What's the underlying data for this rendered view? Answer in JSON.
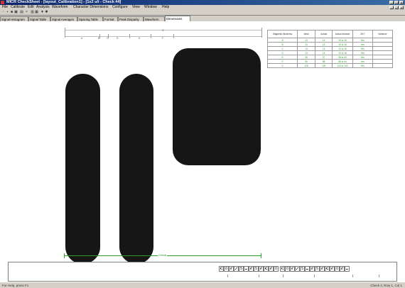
{
  "window": {
    "title": "MICR CheckSheet - [layout_Calibration1] - [1x2 u/i - Check #4]",
    "controls": [
      "_",
      "□",
      "×"
    ],
    "doc_controls": [
      "_",
      "□",
      "×"
    ]
  },
  "menu": [
    "File",
    "Calibrate",
    "Edit",
    "Analysis",
    "Waveform",
    "Character Dimensions",
    "Configure",
    "View",
    "Window",
    "Help"
  ],
  "toolbar_icons": [
    "new-icon",
    "open-icon",
    "save-icon",
    "print-icon",
    "preview-icon",
    "delete-icon",
    "copy-icon",
    "paste-icon",
    "filter-icon",
    "settings-icon"
  ],
  "tabs": [
    "Signal Histogram",
    "Signal Table",
    "Signal Averages",
    "Spacing Table",
    "Format",
    "Peak Disparity",
    "Waveform",
    "Dimensions"
  ],
  "active_tab": "Dimensions",
  "dimensions": {
    "letters": [
      "A",
      "B",
      "C",
      "D",
      "E",
      "F",
      "G"
    ],
    "overall_label": "Overall"
  },
  "results_table": {
    "headers": [
      "Magnetic thickness",
      "Ideal",
      "Actual",
      "Actual allowed",
      "OK?",
      "Variance"
    ],
    "rows": [
      [
        "A",
        "13",
        "14",
        "10 to 16",
        "Yes",
        ""
      ],
      [
        "B",
        "13",
        "13",
        "10 to 16",
        "Yes",
        ""
      ],
      [
        "C",
        "13",
        "14",
        "10 to 16",
        "Yes",
        ""
      ],
      [
        "D",
        "13",
        "14",
        "10 to 16",
        "Yes",
        ""
      ],
      [
        "E",
        "38",
        "37",
        "36 to 40",
        "Yes",
        ""
      ],
      [
        "F",
        "90",
        "88",
        "86 to 94",
        "Yes",
        ""
      ],
      [
        "G",
        "128",
        "126",
        "110 to 130",
        "Yes",
        ""
      ]
    ]
  },
  "sequence": {
    "group1": "⑆0⑈⑇5⑉⑈5⑈⑆⑈0",
    "group2": "⑆0⑈⑇5⑉⑈5⑈⑆⑈0⑈⑉"
  },
  "status": {
    "left": "For Help, press F1",
    "right": "Check 4, Row 1, Col 1"
  }
}
